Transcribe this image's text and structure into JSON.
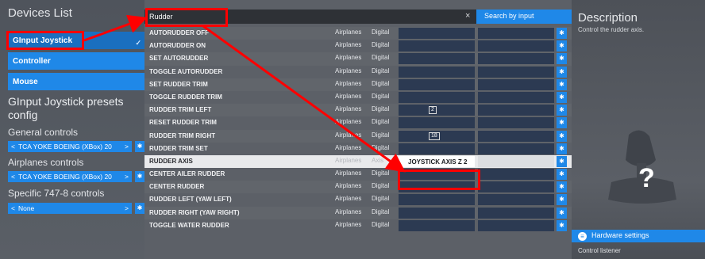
{
  "left": {
    "title": "Devices List",
    "devices": [
      "GInput Joystick",
      "Controller",
      "Mouse"
    ],
    "selected_check": "✓",
    "presets_title": "GInput Joystick presets config",
    "sections": [
      {
        "label": "General controls",
        "value": "TCA YOKE BOEING (XBox) 20",
        "arrow_left": "<",
        "arrow_right": ">"
      },
      {
        "label": "Airplanes controls",
        "value": "TCA YOKE BOEING (XBox) 20",
        "arrow_left": "<",
        "arrow_right": ">"
      },
      {
        "label": "Specific 747-8 controls",
        "value": "None",
        "arrow_left": "<",
        "arrow_right": ">"
      }
    ]
  },
  "search": {
    "value": "Rudder",
    "clear": "×",
    "button": "Search by input"
  },
  "rows": [
    {
      "name": "AUTORUDDER OFF",
      "t1": "Airplanes",
      "t2": "Digital",
      "slot1": ""
    },
    {
      "name": "AUTORUDDER ON",
      "t1": "Airplanes",
      "t2": "Digital",
      "slot1": ""
    },
    {
      "name": "SET AUTORUDDER",
      "t1": "Airplanes",
      "t2": "Digital",
      "slot1": ""
    },
    {
      "name": "TOGGLE AUTORUDDER",
      "t1": "Airplanes",
      "t2": "Digital",
      "slot1": ""
    },
    {
      "name": "SET RUDDER TRIM",
      "t1": "Airplanes",
      "t2": "Digital",
      "slot1": ""
    },
    {
      "name": "TOGGLE RUDDER TRIM",
      "t1": "Airplanes",
      "t2": "Digital",
      "slot1": ""
    },
    {
      "name": "RUDDER TRIM LEFT",
      "t1": "Airplanes",
      "t2": "Digital",
      "slot1": "2"
    },
    {
      "name": "RESET RUDDER TRIM",
      "t1": "Airplanes",
      "t2": "Digital",
      "slot1": ""
    },
    {
      "name": "RUDDER TRIM RIGHT",
      "t1": "Airplanes",
      "t2": "Digital",
      "slot1": "18"
    },
    {
      "name": "RUDDER TRIM SET",
      "t1": "Airplanes",
      "t2": "Digital",
      "slot1": ""
    },
    {
      "name": "RUDDER AXIS",
      "t1": "Airplanes",
      "t2": "Axis",
      "slot1": "JOYSTICK AXIS Z 2"
    },
    {
      "name": "CENTER AILER RUDDER",
      "t1": "Airplanes",
      "t2": "Digital",
      "slot1": ""
    },
    {
      "name": "CENTER RUDDER",
      "t1": "Airplanes",
      "t2": "Digital",
      "slot1": ""
    },
    {
      "name": "RUDDER LEFT (YAW LEFT)",
      "t1": "Airplanes",
      "t2": "Digital",
      "slot1": ""
    },
    {
      "name": "RUDDER RIGHT (YAW RIGHT)",
      "t1": "Airplanes",
      "t2": "Digital",
      "slot1": ""
    },
    {
      "name": "TOGGLE WATER RUDDER",
      "t1": "Airplanes",
      "t2": "Digital",
      "slot1": ""
    }
  ],
  "icons": {
    "gear": "gear-icon",
    "search_clear": "close-icon",
    "hardware": "info-icon",
    "device": "joystick-icon"
  },
  "right": {
    "title": "Description",
    "text": "Control the rudder axis.",
    "question": "?",
    "hardware_button": "Hardware settings",
    "hardware_icon_glyph": "≡",
    "listener": "Control listener"
  },
  "colors": {
    "accent": "#1f88e8",
    "annotation": "#ff0000",
    "highlight_row": "#e9eaec"
  }
}
